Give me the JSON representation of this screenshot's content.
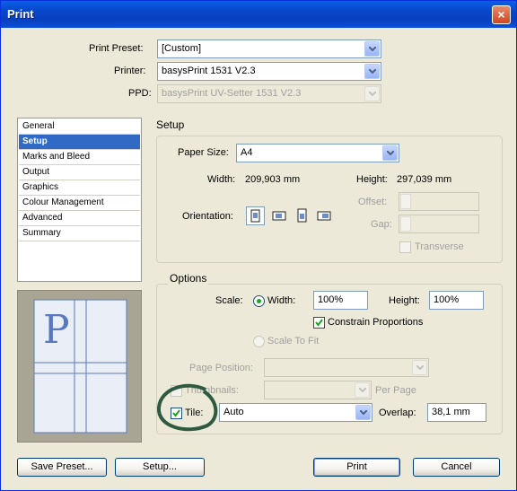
{
  "window": {
    "title": "Print",
    "close_glyph": "×"
  },
  "print_preset": {
    "label": "Print Preset:",
    "value": "[Custom]"
  },
  "printer": {
    "label": "Printer:",
    "value": "basysPrint 1531 V2.3"
  },
  "ppd": {
    "label": "PPD:",
    "value": "basysPrint UV-Setter 1531 V2.3"
  },
  "categories": {
    "items": [
      "General",
      "Setup",
      "Marks and Bleed",
      "Output",
      "Graphics",
      "Colour Management",
      "Advanced",
      "Summary"
    ],
    "selected": "Setup"
  },
  "setup": {
    "heading": "Setup",
    "paper_size": {
      "label": "Paper Size:",
      "value": "A4"
    },
    "width": {
      "label": "Width:",
      "value": "209,903 mm"
    },
    "height": {
      "label": "Height:",
      "value": "297,039 mm"
    },
    "offset": {
      "label": "Offset:",
      "value": ""
    },
    "gap": {
      "label": "Gap:",
      "value": ""
    },
    "transverse": {
      "label": "Transverse",
      "checked": false
    },
    "orientation": {
      "label": "Orientation:",
      "icons": [
        "portrait-icon",
        "landscape-icon",
        "reverse-portrait-icon",
        "reverse-landscape-icon"
      ]
    }
  },
  "options": {
    "heading": "Options",
    "scale_label": "Scale:",
    "width": {
      "label": "Width:",
      "value": "100%"
    },
    "height": {
      "label": "Height:",
      "value": "100%"
    },
    "constrain": {
      "label": "Constrain Proportions",
      "checked": true
    },
    "scale_to_fit": {
      "label": "Scale To Fit"
    },
    "page_position": {
      "label": "Page Position:",
      "value": ""
    },
    "thumbnails": {
      "label": "Thumbnails:",
      "value": "",
      "per_page": "Per Page"
    },
    "tile": {
      "label": "Tile:",
      "checked": true,
      "value": "Auto"
    },
    "overlap": {
      "label": "Overlap:",
      "value": "38,1 mm"
    }
  },
  "preview": {
    "glyph": "P"
  },
  "buttons": {
    "save_preset": "Save Preset...",
    "setup": "Setup...",
    "print": "Print",
    "cancel": "Cancel"
  },
  "colors": {
    "accent": "#316ac5",
    "titlebar": "#0a50d8",
    "annotation_circle": "#2f5a40"
  }
}
